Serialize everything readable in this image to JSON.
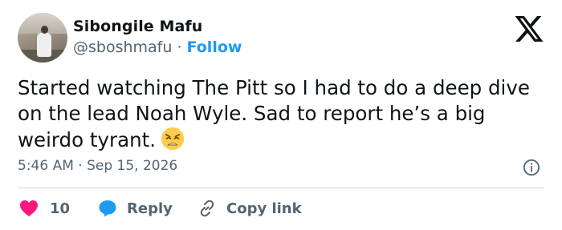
{
  "author": {
    "name": "Sibongile Mafu",
    "handle": "@sboshmafu",
    "separator": " · ",
    "follow_label": "Follow"
  },
  "tweet": {
    "text": "Started watching The Pitt so I had to do a deep dive on the lead Noah Wyle. Sad to report he’s a big weirdo tyrant.",
    "emoji": "weary-face-emoji"
  },
  "meta": {
    "timestamp": "5:46 AM · Sep 15, 2026"
  },
  "actions": {
    "like_count": "10",
    "reply_label": "Reply",
    "copy_label": "Copy link"
  },
  "icons": {
    "logo": "x-logo-icon",
    "info": "info-icon",
    "like": "heart-icon",
    "reply": "reply-bubble-icon",
    "copy": "link-icon"
  },
  "colors": {
    "text": "#0f1419",
    "secondary": "#536471",
    "accent": "#1d9bf0",
    "like": "#f91880",
    "divider": "#cfd9de"
  }
}
